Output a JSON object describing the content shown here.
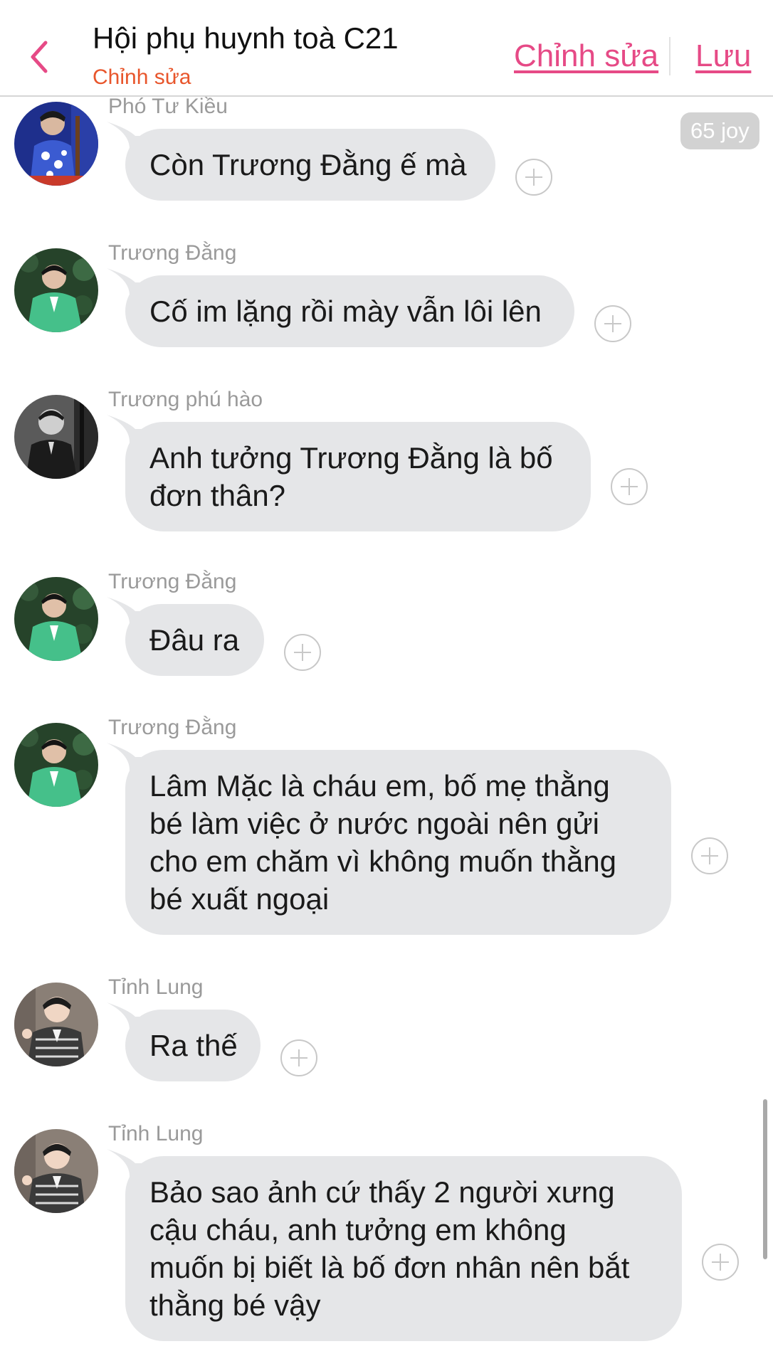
{
  "header": {
    "back_icon": "chevron-left-icon",
    "title": "Hội phụ huynh toà C21",
    "subtitle": "Chỉnh sửa",
    "edit_label": "Chỉnh sửa",
    "save_label": "Lưu",
    "accent_color": "#e64a86",
    "subtitle_color": "#e8562c"
  },
  "reaction_count": "65 joy",
  "messages": [
    {
      "sender": "Phó Tư Kiều",
      "text": "Còn Trương Đằng ế mà"
    },
    {
      "sender": "Trương Đằng",
      "text": "Cố im lặng rồi mày vẫn lôi lên"
    },
    {
      "sender": "Trương phú hào",
      "text": "Anh tưởng Trương Đằng là bố\nđơn thân?"
    },
    {
      "sender": "Trương Đằng",
      "text": "Đâu ra"
    },
    {
      "sender": "Trương Đằng",
      "text": "Lâm Mặc là cháu em, bố mẹ thằng\nbé làm việc ở nước ngoài nên gửi\ncho em chăm vì không muốn thằng\nbé xuất ngoại"
    },
    {
      "sender": "Tỉnh Lung",
      "text": "Ra thế"
    },
    {
      "sender": "Tỉnh Lung",
      "text": "Bảo sao ảnh cứ thấy 2 người xưng\ncậu cháu, anh tưởng em không\nmuốn bị biết là bố đơn nhân nên bắt\nthằng bé vậy"
    }
  ],
  "bubble_color": "#e5e6e8"
}
